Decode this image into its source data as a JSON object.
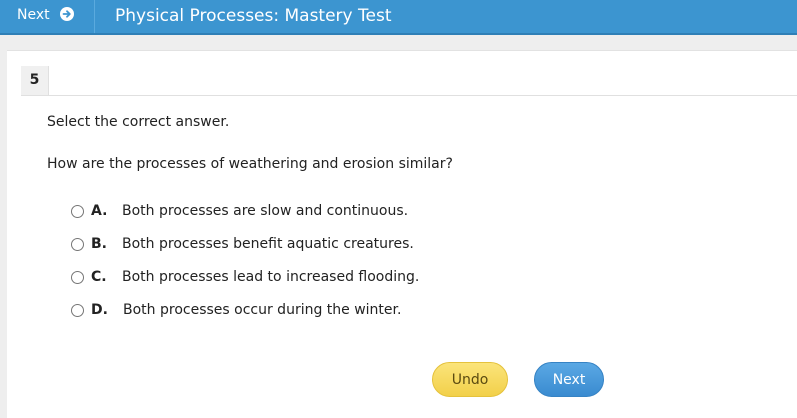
{
  "header": {
    "next_label": "Next",
    "next_icon": "arrow-circle-right-icon",
    "title": "Physical Processes: Mastery Test",
    "bar_color": "#3c95d0"
  },
  "question": {
    "number": "5",
    "instruction": "Select the correct answer.",
    "prompt": "How are the processes of weathering and erosion similar?",
    "options": [
      {
        "letter": "A.",
        "text": "Both processes are slow and continuous."
      },
      {
        "letter": "B.",
        "text": "Both processes benefit aquatic creatures."
      },
      {
        "letter": "C.",
        "text": "Both processes lead to increased flooding."
      },
      {
        "letter": "D.",
        "text": "Both processes occur during the winter."
      }
    ]
  },
  "actions": {
    "undo_label": "Undo",
    "next_label": "Next",
    "undo_color": "#f2d04a",
    "next_color": "#3a8bd0"
  }
}
